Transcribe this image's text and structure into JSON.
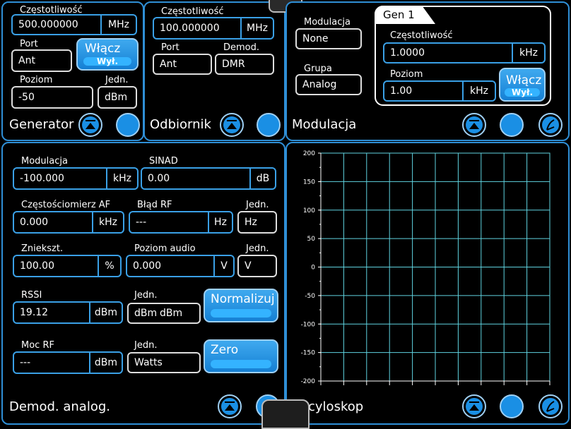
{
  "generator": {
    "freq_label": "Częstotliwość",
    "freq_value": "500.000000",
    "freq_unit": "MHz",
    "port_label": "Port",
    "port_value": "Ant",
    "on_title": "Włącz",
    "on_state": "Wył.",
    "level_label": "Poziom",
    "level_value": "-50",
    "unit_label": "Jedn.",
    "unit_value": "dBm",
    "title": "Generator"
  },
  "receiver": {
    "freq_label": "Częstotliwość",
    "freq_value": "100.000000",
    "freq_unit": "MHz",
    "port_label": "Port",
    "port_value": "Ant",
    "demod_label": "Demod.",
    "demod_value": "DMR",
    "title": "Odbiornik"
  },
  "modulation": {
    "mod_label": "Modulacja",
    "mod_value": "None",
    "group_label": "Grupa",
    "group_value": "Analog",
    "gen_tab": "Gen 1",
    "freq_label": "Częstotliwość",
    "freq_value": "1.0000",
    "freq_unit": "kHz",
    "level_label": "Poziom",
    "level_value": "1.00",
    "level_unit": "kHz",
    "on_title": "Włącz",
    "on_state": "Wył.",
    "title": "Modulacja"
  },
  "demod": {
    "mod_label": "Modulacja",
    "mod_value": "-100.000",
    "mod_unit": "kHz",
    "sinad_label": "SINAD",
    "sinad_value": "0.00",
    "sinad_unit": "dB",
    "af_label": "Częstościomierz AF",
    "af_value": "0.000",
    "af_unit": "kHz",
    "rferr_label": "Błąd RF",
    "rferr_value": "---",
    "rferr_unit": "Hz",
    "unit1_label": "Jedn.",
    "unit1_value": "Hz",
    "dist_label": "Zniekszt.",
    "dist_value": "100.00",
    "dist_unit": "%",
    "audio_label": "Poziom audio",
    "audio_value": "0.000",
    "audio_unit": "V",
    "unit2_label": "Jedn.",
    "unit2_value": "V",
    "rssi_label": "RSSI",
    "rssi_value": "19.12",
    "rssi_unit": "dBm",
    "unit3_label": "Jedn.",
    "unit3_value": "dBm",
    "unit3_overlap": "dBm",
    "normalize": "Normalizuj",
    "rfpow_label": "Moc RF",
    "rfpow_value": "---",
    "rfpow_unit": "dBm",
    "unit4_label": "Jedn.",
    "unit4_value": "Watts",
    "zero": "Zero",
    "title": "Demod. analog."
  },
  "scope": {
    "title": "cyloskop",
    "ticks": [
      "200",
      "150",
      "100",
      "50",
      "0",
      "-50",
      "-100",
      "-150",
      "-200"
    ],
    "grid_color": "#5fd3e0"
  },
  "chart_data": {
    "type": "line",
    "title": "",
    "xlabel": "",
    "ylabel": "",
    "ylim": [
      -200,
      200
    ],
    "yticks": [
      200,
      150,
      100,
      50,
      0,
      -50,
      -100,
      -150,
      -200
    ],
    "grid": true,
    "series": []
  }
}
